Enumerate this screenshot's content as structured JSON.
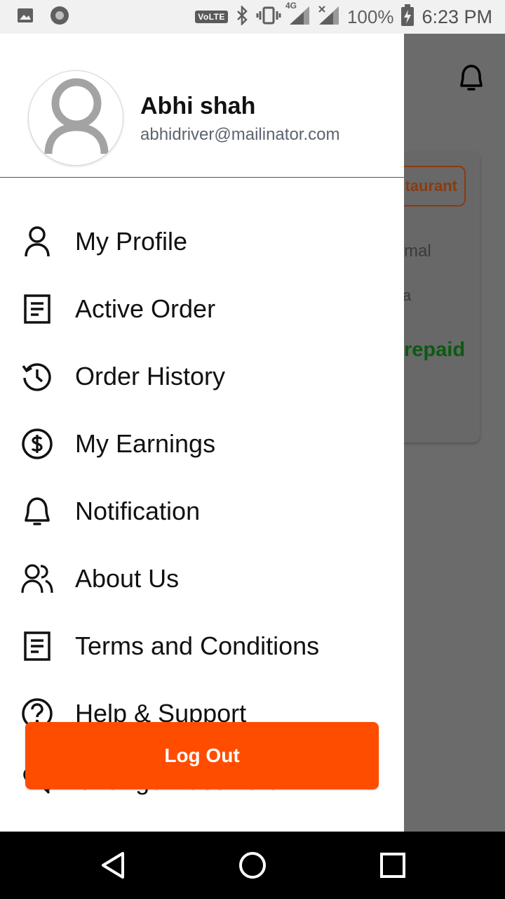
{
  "status_bar": {
    "volte": "VoLTE",
    "network": "4G",
    "battery": "100%",
    "time": "6:23 PM",
    "icons": [
      "image-icon",
      "record-icon",
      "bluetooth-icon",
      "vibrate-icon",
      "signal-icon",
      "signal-icon",
      "battery-charging-icon"
    ]
  },
  "background": {
    "chip_text": "staurant",
    "text1": "mal",
    "text2": "a",
    "payment_status": "repaid"
  },
  "drawer": {
    "user": {
      "name": "Abhi shah",
      "email": "abhidriver@mailinator.com"
    },
    "menu": [
      {
        "label": "My Profile",
        "icon": "user-icon"
      },
      {
        "label": "Active Order",
        "icon": "document-icon"
      },
      {
        "label": "Order History",
        "icon": "history-icon"
      },
      {
        "label": "My Earnings",
        "icon": "dollar-circle-icon"
      },
      {
        "label": "Notification",
        "icon": "bell-icon"
      },
      {
        "label": "About Us",
        "icon": "users-icon"
      },
      {
        "label": "Terms and Conditions",
        "icon": "document-icon"
      },
      {
        "label": "Help & Support",
        "icon": "help-circle-icon"
      },
      {
        "label": "Change Password",
        "icon": "key-icon"
      }
    ],
    "logout_label": "Log Out"
  },
  "colors": {
    "accent": "#ff4d00",
    "overlay": "#6b6b6b",
    "prepaid": "#0c5a12"
  }
}
